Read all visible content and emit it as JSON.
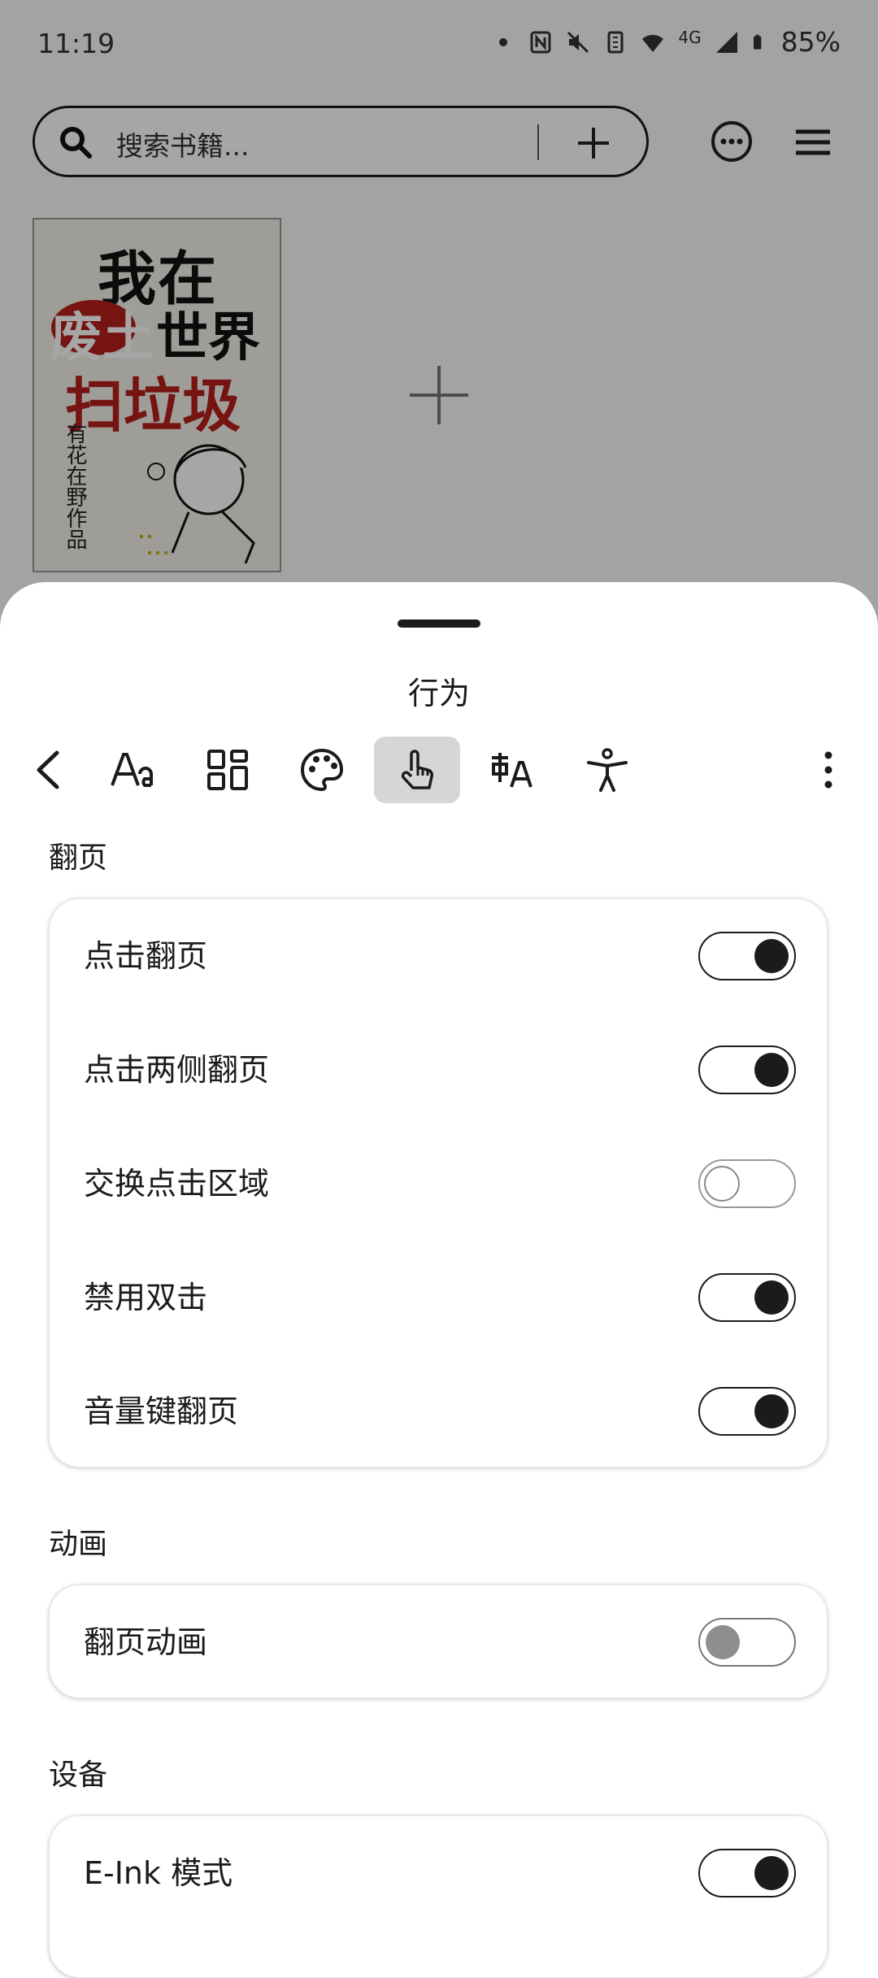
{
  "status_bar": {
    "time": "11:19",
    "network": "4G",
    "battery": "85%"
  },
  "library": {
    "search_placeholder": "搜索书籍...",
    "book": {
      "cover_line1": "我在",
      "cover_line2_red": "废土",
      "cover_line2_black": "世界",
      "cover_line3": "扫垃圾",
      "cover_author": "有花在野作品"
    }
  },
  "sheet": {
    "title": "行为",
    "toolbar_icons": [
      "back-icon",
      "font-icon",
      "layout-grid-icon",
      "palette-icon",
      "touch-hand-icon",
      "translate-icon",
      "accessibility-icon",
      "more-vert-icon"
    ],
    "active_tab": "touch-hand-icon",
    "sections": [
      {
        "label": "翻页",
        "items": [
          {
            "label": "点击翻页",
            "state": "on"
          },
          {
            "label": "点击两侧翻页",
            "state": "on"
          },
          {
            "label": "交换点击区域",
            "state": "off"
          },
          {
            "label": "禁用双击",
            "state": "on"
          },
          {
            "label": "音量键翻页",
            "state": "on"
          }
        ]
      },
      {
        "label": "动画",
        "items": [
          {
            "label": "翻页动画",
            "state": "disabled-off"
          }
        ]
      },
      {
        "label": "设备",
        "items": [
          {
            "label": "E-Ink 模式",
            "state": "on"
          }
        ]
      }
    ]
  },
  "colors": {
    "toggle_on": "#1b1b1b",
    "active_tab_bg": "#d6d6d6",
    "cover_red": "#b5201c"
  }
}
